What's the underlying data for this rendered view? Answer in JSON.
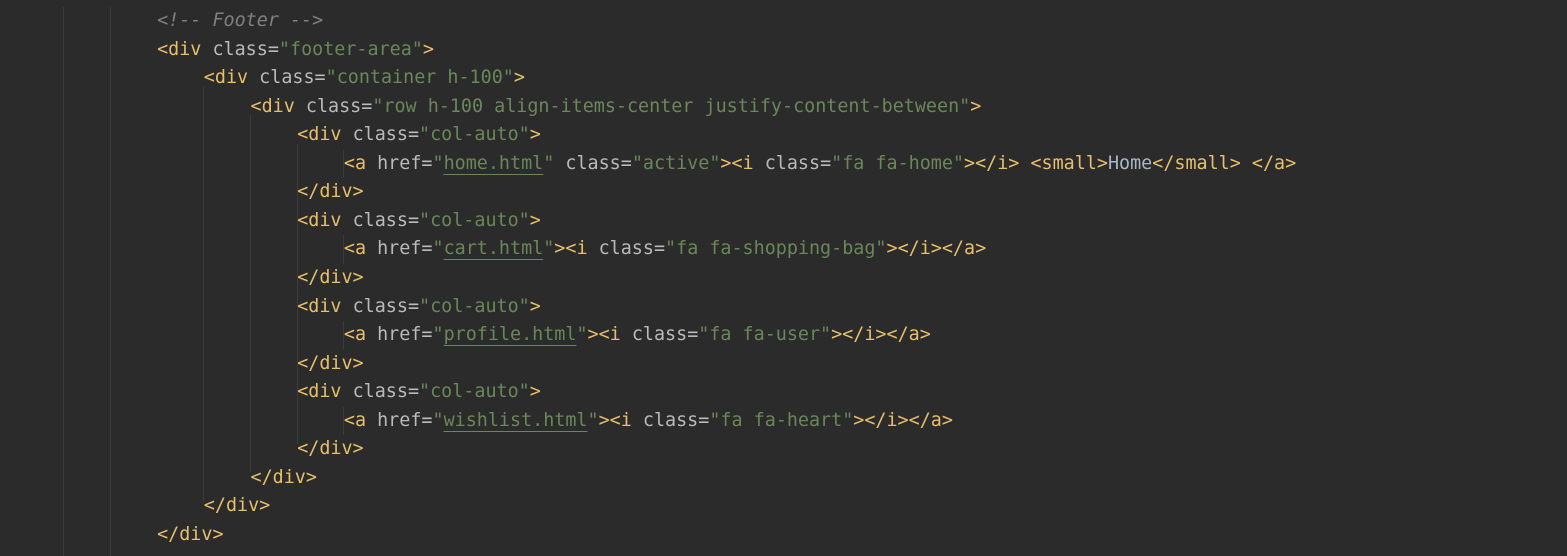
{
  "colors": {
    "background": "#2b2b2b",
    "comment": "#808080",
    "tag": "#e8bf6a",
    "attribute": "#bababa",
    "string": "#6a8759",
    "text": "#a9b7c6",
    "indent_guide": "#3b3b3b"
  },
  "code_lines": [
    {
      "indent": 3,
      "tokens": [
        {
          "t": "comment",
          "v": "<!-- Footer -->"
        }
      ]
    },
    {
      "indent": 3,
      "tokens": [
        {
          "t": "tag",
          "v": "<div "
        },
        {
          "t": "attr",
          "v": "class"
        },
        {
          "t": "eq",
          "v": "="
        },
        {
          "t": "value",
          "v": "\"footer-area\""
        },
        {
          "t": "tag",
          "v": ">"
        }
      ]
    },
    {
      "indent": 4,
      "tokens": [
        {
          "t": "tag",
          "v": "<div "
        },
        {
          "t": "attr",
          "v": "class"
        },
        {
          "t": "eq",
          "v": "="
        },
        {
          "t": "value",
          "v": "\"container h-100\""
        },
        {
          "t": "tag",
          "v": ">"
        }
      ]
    },
    {
      "indent": 5,
      "tokens": [
        {
          "t": "tag",
          "v": "<div "
        },
        {
          "t": "attr",
          "v": "class"
        },
        {
          "t": "eq",
          "v": "="
        },
        {
          "t": "value",
          "v": "\"row h-100 align-items-center justify-content-between\""
        },
        {
          "t": "tag",
          "v": ">"
        }
      ]
    },
    {
      "indent": 6,
      "tokens": [
        {
          "t": "tag",
          "v": "<div "
        },
        {
          "t": "attr",
          "v": "class"
        },
        {
          "t": "eq",
          "v": "="
        },
        {
          "t": "value",
          "v": "\"col-auto\""
        },
        {
          "t": "tag",
          "v": ">"
        }
      ]
    },
    {
      "indent": 7,
      "tokens": [
        {
          "t": "tag",
          "v": "<a "
        },
        {
          "t": "attr",
          "v": "href"
        },
        {
          "t": "eq",
          "v": "="
        },
        {
          "t": "value",
          "v": "\""
        },
        {
          "t": "link",
          "v": "home.html"
        },
        {
          "t": "value",
          "v": "\""
        },
        {
          "t": "attr",
          "v": " class"
        },
        {
          "t": "eq",
          "v": "="
        },
        {
          "t": "value",
          "v": "\"active\""
        },
        {
          "t": "tag",
          "v": "><i "
        },
        {
          "t": "attr",
          "v": "class"
        },
        {
          "t": "eq",
          "v": "="
        },
        {
          "t": "value",
          "v": "\"fa fa-home\""
        },
        {
          "t": "tag",
          "v": "></i> <small>"
        },
        {
          "t": "text",
          "v": "Home"
        },
        {
          "t": "tag",
          "v": "</small> </a>"
        }
      ]
    },
    {
      "indent": 6,
      "tokens": [
        {
          "t": "tag",
          "v": "</div>"
        }
      ]
    },
    {
      "indent": 6,
      "tokens": [
        {
          "t": "tag",
          "v": "<div "
        },
        {
          "t": "attr",
          "v": "class"
        },
        {
          "t": "eq",
          "v": "="
        },
        {
          "t": "value",
          "v": "\"col-auto\""
        },
        {
          "t": "tag",
          "v": ">"
        }
      ]
    },
    {
      "indent": 7,
      "tokens": [
        {
          "t": "tag",
          "v": "<a "
        },
        {
          "t": "attr",
          "v": "href"
        },
        {
          "t": "eq",
          "v": "="
        },
        {
          "t": "value",
          "v": "\""
        },
        {
          "t": "link",
          "v": "cart.html"
        },
        {
          "t": "value",
          "v": "\""
        },
        {
          "t": "tag",
          "v": "><i "
        },
        {
          "t": "attr",
          "v": "class"
        },
        {
          "t": "eq",
          "v": "="
        },
        {
          "t": "value",
          "v": "\"fa fa-shopping-bag\""
        },
        {
          "t": "tag",
          "v": "></i></a>"
        }
      ]
    },
    {
      "indent": 6,
      "tokens": [
        {
          "t": "tag",
          "v": "</div>"
        }
      ]
    },
    {
      "indent": 6,
      "tokens": [
        {
          "t": "tag",
          "v": "<div "
        },
        {
          "t": "attr",
          "v": "class"
        },
        {
          "t": "eq",
          "v": "="
        },
        {
          "t": "value",
          "v": "\"col-auto\""
        },
        {
          "t": "tag",
          "v": ">"
        }
      ]
    },
    {
      "indent": 7,
      "tokens": [
        {
          "t": "tag",
          "v": "<a "
        },
        {
          "t": "attr",
          "v": "href"
        },
        {
          "t": "eq",
          "v": "="
        },
        {
          "t": "value",
          "v": "\""
        },
        {
          "t": "link",
          "v": "profile.html"
        },
        {
          "t": "value",
          "v": "\""
        },
        {
          "t": "tag",
          "v": "><i "
        },
        {
          "t": "attr",
          "v": "class"
        },
        {
          "t": "eq",
          "v": "="
        },
        {
          "t": "value",
          "v": "\"fa fa-user\""
        },
        {
          "t": "tag",
          "v": "></i></a>"
        }
      ]
    },
    {
      "indent": 6,
      "tokens": [
        {
          "t": "tag",
          "v": "</div>"
        }
      ]
    },
    {
      "indent": 6,
      "tokens": [
        {
          "t": "tag",
          "v": "<div "
        },
        {
          "t": "attr",
          "v": "class"
        },
        {
          "t": "eq",
          "v": "="
        },
        {
          "t": "value",
          "v": "\"col-auto\""
        },
        {
          "t": "tag",
          "v": ">"
        }
      ]
    },
    {
      "indent": 7,
      "tokens": [
        {
          "t": "tag",
          "v": "<a "
        },
        {
          "t": "attr",
          "v": "href"
        },
        {
          "t": "eq",
          "v": "="
        },
        {
          "t": "value",
          "v": "\""
        },
        {
          "t": "link",
          "v": "wishlist.html"
        },
        {
          "t": "value",
          "v": "\""
        },
        {
          "t": "tag",
          "v": "><i "
        },
        {
          "t": "attr",
          "v": "class"
        },
        {
          "t": "eq",
          "v": "="
        },
        {
          "t": "value",
          "v": "\"fa fa-heart\""
        },
        {
          "t": "tag",
          "v": "></i></a>"
        }
      ]
    },
    {
      "indent": 6,
      "tokens": [
        {
          "t": "tag",
          "v": "</div>"
        }
      ]
    },
    {
      "indent": 5,
      "tokens": [
        {
          "t": "tag",
          "v": "</div>"
        }
      ]
    },
    {
      "indent": 4,
      "tokens": [
        {
          "t": "tag",
          "v": "</div>"
        }
      ]
    },
    {
      "indent": 3,
      "tokens": [
        {
          "t": "tag",
          "v": "</div>"
        }
      ]
    }
  ]
}
